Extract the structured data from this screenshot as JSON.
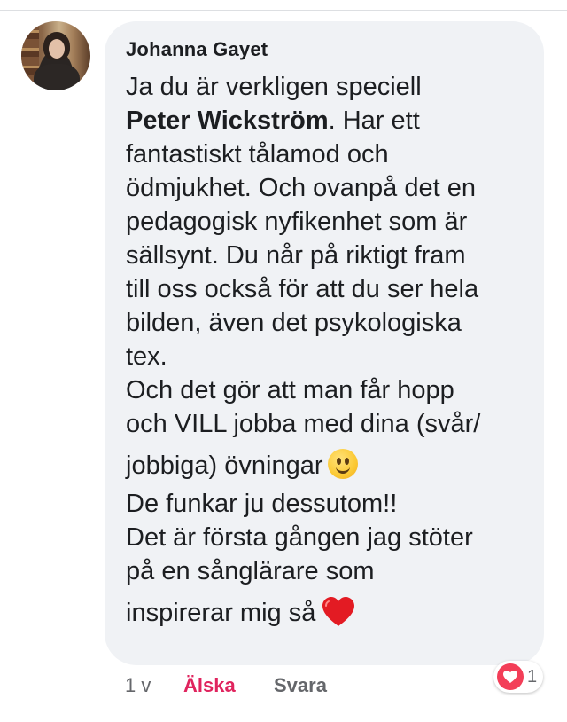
{
  "comment": {
    "author": "Johanna Gayet",
    "lines": [
      "Ja du är verkligen speciell",
      "Peter Wickström",
      ". Har ett",
      "fantastiskt tålamod och",
      "ödmjukhet. Och ovanpå det en",
      "pedagogisk nyfikenhet som är",
      "sällsynt. Du når på riktigt fram",
      "till oss också för att du ser hela",
      "bilden, även det psykologiska",
      "tex.",
      "Och det gör att man får hopp",
      "och VILL jobba med dina (svår/",
      "jobbiga) övningar",
      "De funkar ju dessutom!!",
      "Det är första gången jag stöter",
      "på en sånglärare som",
      "inspirerar mig så"
    ],
    "emojis": {
      "smile": "slightly-smiling-face-emoji",
      "heart": "red-heart-emoji"
    }
  },
  "meta": {
    "time": "1 v",
    "love_label": "Älska",
    "reply_label": "Svara"
  },
  "reactions": {
    "icon": "love-reaction-icon",
    "count": "1",
    "color": "#f33e58"
  }
}
